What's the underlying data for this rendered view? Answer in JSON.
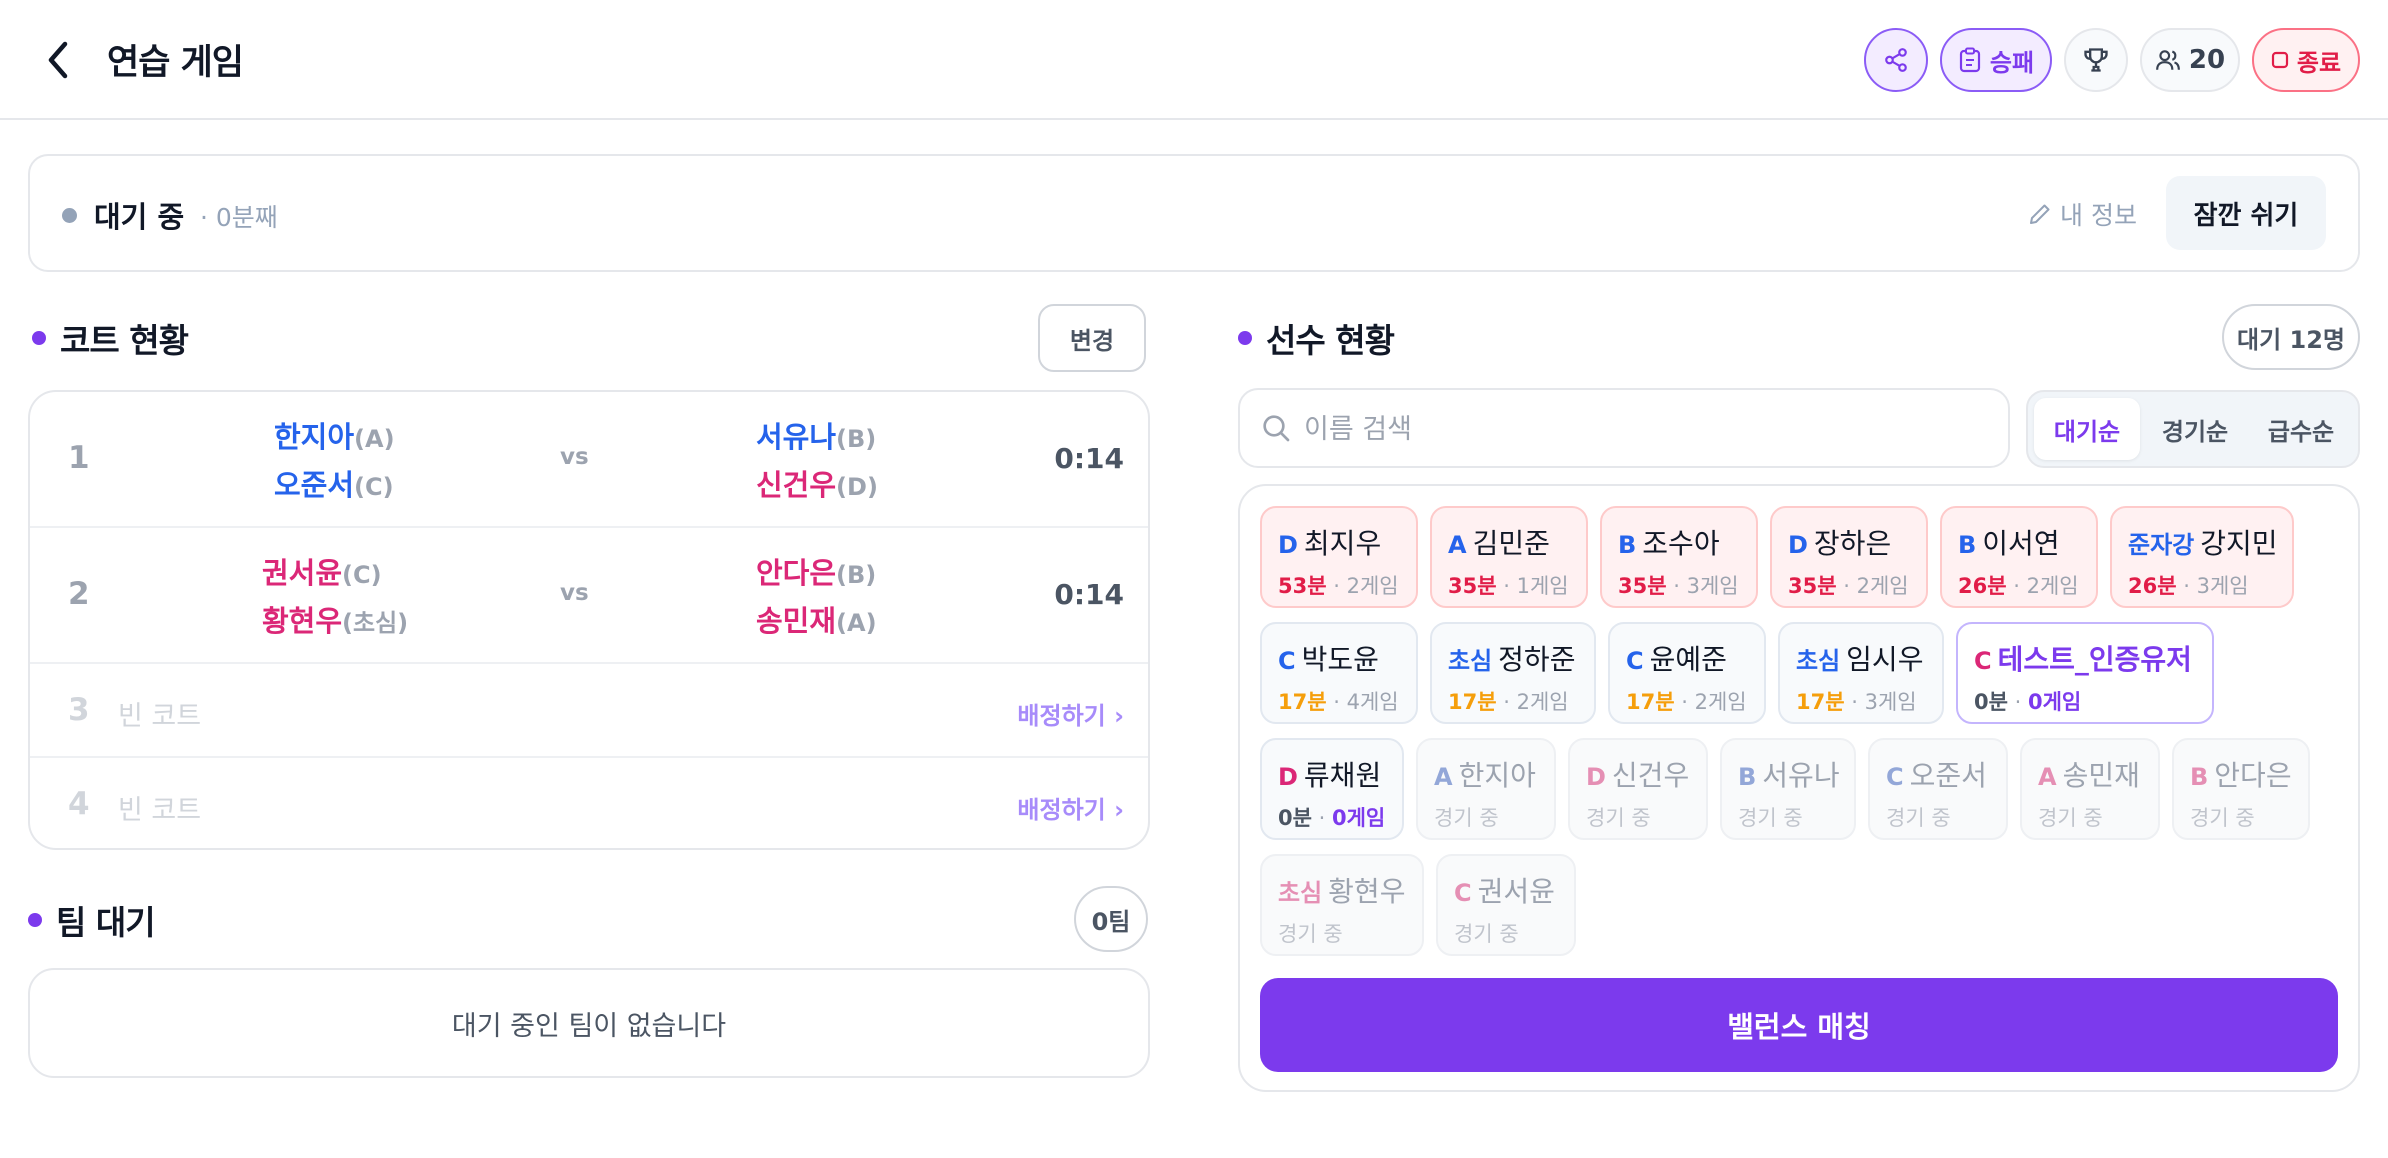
{
  "header": {
    "title": "연습 게임",
    "record_label": "승패",
    "people_count": "20",
    "end_label": "종료"
  },
  "status": {
    "state": "대기 중",
    "sub": "· 0분째",
    "myinfo_label": "내 정보",
    "rest_label": "잠깐 쉬기"
  },
  "courts": {
    "title": "코트 현황",
    "change_label": "변경",
    "vs": "vs",
    "rows": [
      {
        "num": "1",
        "a1": "한지아",
        "a1g": "(A)",
        "a2": "오준서",
        "a2g": "(C)",
        "b1": "서유나",
        "b1g": "(B)",
        "b2": "신건우",
        "b2g": "(D)",
        "time": "0:14"
      },
      {
        "num": "2",
        "a1": "권서윤",
        "a1g": "(C)",
        "a2": "황현우",
        "a2g": "(초심)",
        "b1": "안다은",
        "b1g": "(B)",
        "b2": "송민재",
        "b2g": "(A)",
        "time": "0:14"
      },
      {
        "num": "3",
        "empty": "빈 코트",
        "assign": "배정하기 ›"
      },
      {
        "num": "4",
        "empty": "빈 코트",
        "assign": "배정하기 ›"
      }
    ]
  },
  "team_wait": {
    "title": "팀 대기",
    "count": "0팀",
    "empty": "대기 중인 팀이 없습니다"
  },
  "players": {
    "title": "선수 현황",
    "waiting_count": "대기 12명",
    "search_placeholder": "이름 검색",
    "sort_tabs": [
      "대기순",
      "경기순",
      "급수순"
    ],
    "sep": "·",
    "list": [
      {
        "g": "D",
        "name": "최지우",
        "time": "53분",
        "games": "2게임"
      },
      {
        "g": "A",
        "name": "김민준",
        "time": "35분",
        "games": "1게임"
      },
      {
        "g": "B",
        "name": "조수아",
        "time": "35분",
        "games": "3게임"
      },
      {
        "g": "D",
        "name": "장하은",
        "time": "35분",
        "games": "2게임"
      },
      {
        "g": "B",
        "name": "이서연",
        "time": "26분",
        "games": "2게임"
      },
      {
        "g": "준자강",
        "name": "강지민",
        "time": "26분",
        "games": "3게임"
      },
      {
        "g": "C",
        "name": "박도윤",
        "time": "17분",
        "games": "4게임"
      },
      {
        "g": "초심",
        "name": "정하준",
        "time": "17분",
        "games": "2게임"
      },
      {
        "g": "C",
        "name": "윤예준",
        "time": "17분",
        "games": "2게임"
      },
      {
        "g": "초심",
        "name": "임시우",
        "time": "17분",
        "games": "3게임"
      },
      {
        "g": "C",
        "name": "테스트_인증유저",
        "time": "0분",
        "games": "0게임"
      },
      {
        "g": "D",
        "name": "류채원",
        "time": "0분",
        "games": "0게임"
      },
      {
        "g": "A",
        "name": "한지아",
        "status": "경기 중"
      },
      {
        "g": "D",
        "name": "신건우",
        "status": "경기 중"
      },
      {
        "g": "B",
        "name": "서유나",
        "status": "경기 중"
      },
      {
        "g": "C",
        "name": "오준서",
        "status": "경기 중"
      },
      {
        "g": "A",
        "name": "송민재",
        "status": "경기 중"
      },
      {
        "g": "B",
        "name": "안다은",
        "status": "경기 중"
      },
      {
        "g": "초심",
        "name": "황현우",
        "status": "경기 중"
      },
      {
        "g": "C",
        "name": "권서윤",
        "status": "경기 중"
      }
    ],
    "balance_label": "밸런스 매칭"
  },
  "colors": {
    "accent": "#7c3aed",
    "male": "#2563eb",
    "female": "#db2777",
    "danger": "#e11d48"
  }
}
